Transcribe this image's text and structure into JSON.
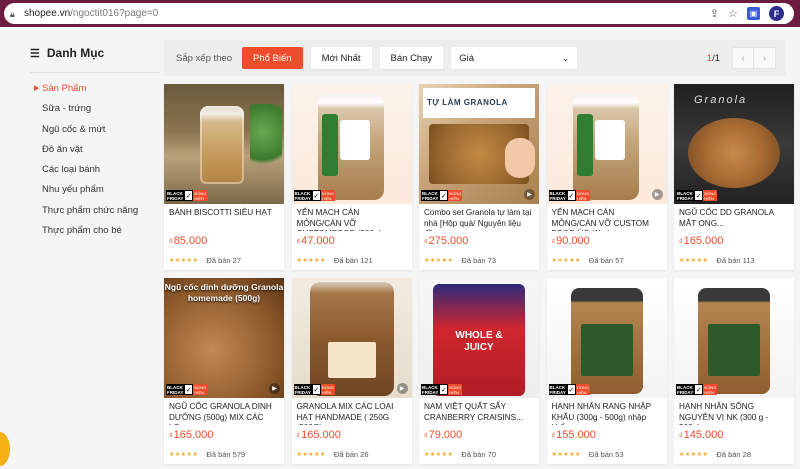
{
  "browser": {
    "domain": "shopee.vn",
    "path": "/ngoctit016?page=0",
    "profile_letter": "F"
  },
  "sidebar": {
    "title": "Danh Mục",
    "items": [
      {
        "label": "Sản Phẩm",
        "active": true
      },
      {
        "label": "Sữa - trứng"
      },
      {
        "label": "Ngũ cốc & mứt"
      },
      {
        "label": "Đồ ăn vặt"
      },
      {
        "label": "Các loại bánh"
      },
      {
        "label": "Nhu yếu phẩm"
      },
      {
        "label": "Thực phẩm chức năng"
      },
      {
        "label": "Thực phẩm cho bé"
      }
    ]
  },
  "sortbar": {
    "label": "Sắp xếp theo",
    "options": [
      "Phổ Biến",
      "Mới Nhất",
      "Bán Chạy"
    ],
    "active": "Phổ Biến",
    "price_select": "Giá",
    "page_current": "1",
    "page_total": "/1"
  },
  "badge": {
    "bf_line1": "BLACK",
    "bf_line2": "FRIDAY",
    "dr_line1": "ĐỒNG",
    "dr_line2": "HIỆN"
  },
  "products": [
    {
      "title": "BÁNH BISCOTTI SIÊU HẠT",
      "currency": "₫",
      "price": "85.000",
      "sold": "Đã bán 27",
      "art": "cafe"
    },
    {
      "title": "YẾN MẠCH CÁN MỎNG/CÁN VỠ CUSTOMFOOD (500g)",
      "currency": "₫",
      "price": "47.000",
      "sold": "Đã bán 121",
      "art": "white"
    },
    {
      "title": "Combo set Granola tự làm tại nhà [Hộp quà/ Nguyên liệu đồ...",
      "currency": "₫",
      "price": "275.000",
      "sold": "Đã bán 73",
      "art": "granola",
      "art_text": "TỰ LÀM GRANOLA"
    },
    {
      "title": "YẾN MẠCH CÁN MỎNG/CÁN VỠ CUSTOM FOOD ÚC (1kg)",
      "currency": "₫",
      "price": "90.000",
      "sold": "Đã bán 57",
      "art": "white"
    },
    {
      "title": "NGŨ CỐC DD GRANOLA MẮT ONG...",
      "currency": "₫",
      "price": "165.000",
      "sold": "Đã bán 113",
      "art": "dark",
      "art_text": "Granola"
    },
    {
      "title": "NGŨ CỐC GRANOLA DINH DƯỠNG (500g) MIX CÁC LO...",
      "currency": "₫",
      "price": "165.000",
      "sold": "Đã bán 579",
      "art": "nuts",
      "art_text": "Ngũ cốc dinh dưỡng Granola homemade (500g)"
    },
    {
      "title": "GRANOLA MIX CÁC LOẠI HẠT HANDMADE ( 250G -500G)",
      "currency": "₫",
      "price": "165.000",
      "sold": "Đã bán 26",
      "art": "glass"
    },
    {
      "title": "NAM VIỆT QUẤT SẤY CRANBERRY CRAISINS...",
      "currency": "₫",
      "price": "79.000",
      "sold": "Đã bán 70",
      "art": "cran",
      "art_text": "WHOLE & JUICY"
    },
    {
      "title": "HẠNH NHÂN RANG NHẬP KHẨU (300g - 500g) nhập khẩu",
      "currency": "₫",
      "price": "155.000",
      "sold": "Đã bán 53",
      "art": "almond"
    },
    {
      "title": "HẠNH NHÂN SỐNG NGUYÊN VỊ NK (300 g - 500g)",
      "currency": "₫",
      "price": "145.000",
      "sold": "Đã bán 28",
      "art": "almond"
    }
  ],
  "colors": {
    "accent": "#ee4d2d",
    "browser_bar": "#6b1c3f",
    "star": "#f5a623"
  }
}
